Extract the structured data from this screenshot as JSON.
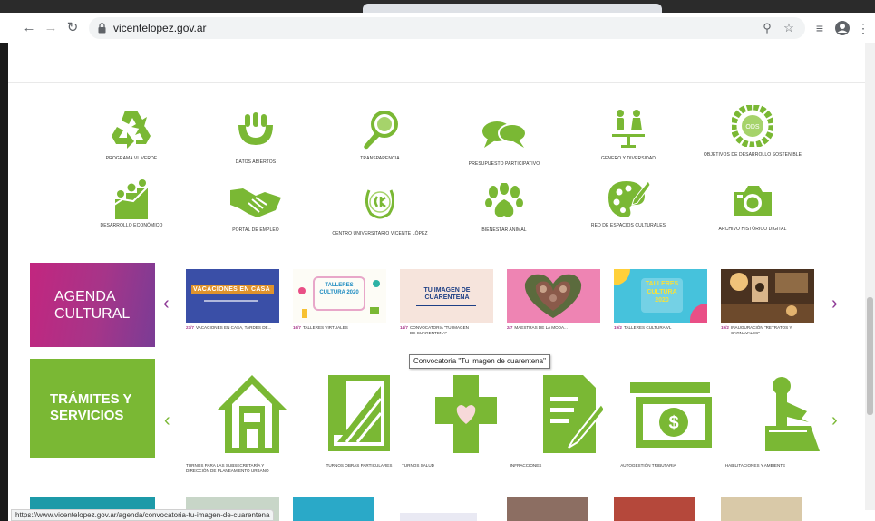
{
  "browser": {
    "url": "vicentelopez.gov.ar",
    "status_url": "https://www.vicentelopez.gov.ar/agenda/convocatoria-tu-imagen-de-cuarentena",
    "icons": [
      "back-arrow-icon",
      "forward-arrow-icon",
      "reload-icon",
      "lock-icon",
      "zoom-icon",
      "star-icon",
      "reading-list-icon",
      "profile-icon",
      "more-icon"
    ]
  },
  "grid": {
    "row1": [
      {
        "label": "PROGRAMA VL VERDE",
        "icon": "recycle-icon"
      },
      {
        "label": "DATOS ABIERTOS",
        "icon": "open-data-icon"
      },
      {
        "label": "TRANSPARENCIA",
        "icon": "magnifier-icon"
      },
      {
        "label": "PRESUPUESTO PARTICIPATIVO",
        "icon": "speech-bubbles-icon"
      },
      {
        "label": "GENERO Y DIVERSIDAD",
        "icon": "people-balance-icon"
      },
      {
        "label": "OBJETIVOS DE DESARROLLO SOSTENIBLE",
        "icon": "ods-wheel-icon"
      }
    ],
    "row2": [
      {
        "label": "DESARROLLO ECONÓMICO",
        "icon": "growth-people-icon"
      },
      {
        "label": "PORTAL DE EMPLEO",
        "icon": "handshake-icon"
      },
      {
        "label": "CENTRO UNIVERSITARIO VICENTE LÓPEZ",
        "icon": "laurel-emblem-icon"
      },
      {
        "label": "BIENESTAR ANIMAL",
        "icon": "paw-icon"
      },
      {
        "label": "RED DE ESPACIOS CULTURALES",
        "icon": "palette-icon"
      },
      {
        "label": "ARCHIVO HISTÓRICO DIGITAL",
        "icon": "camera-icon"
      }
    ],
    "ods_text": "ODS"
  },
  "agenda": {
    "title": "AGENDA CULTURAL",
    "items": [
      {
        "date": "23/7",
        "caption": "VACACIONES EN CASA, TARDES DE...",
        "image_text": "VACACIONES EN CASA"
      },
      {
        "date": "16/7",
        "caption": "TALLERES VIRTUALES",
        "image_text": "TALLERES CULTURA 2020"
      },
      {
        "date": "14/7",
        "caption": "CONVOCATORIA \"TU IMAGEN DE CUARENTENA\"",
        "image_text": "TU IMAGEN DE CUARENTENA"
      },
      {
        "date": "2/7",
        "caption": "MAESTRAS DE LA MODA...",
        "image_text": ""
      },
      {
        "date": "19/2",
        "caption": "TALLERES CULTURA VL",
        "image_text": "TALLERES CULTURA 2020"
      },
      {
        "date": "19/2",
        "caption": "INAUGURACIÓN \"RETRATOS Y CARNAVALES\"",
        "image_text": ""
      }
    ]
  },
  "tooltip": "Convocatoria \"Tu imagen de cuarentena\"",
  "tramites": {
    "title": "TRÁMITES Y SERVICIOS",
    "items": [
      {
        "label": "TURNOS PARA LAS SUBSECRETARÍA Y DIRECCIÓN DE PLANEAMIENTO URBANO",
        "icon": "house-icon"
      },
      {
        "label": "TURNOS OBRAS PARTICULARES",
        "icon": "blueprint-icon"
      },
      {
        "label": "TURNOS SALUD",
        "icon": "health-cross-icon"
      },
      {
        "label": "INFRACCIONES",
        "icon": "document-edit-icon"
      },
      {
        "label": "AUTOGESTIÓN TRIBUTARIA",
        "icon": "money-bill-icon"
      },
      {
        "label": "HABILITACIONES Y AMBIENTE",
        "icon": "stamp-icon"
      }
    ]
  },
  "colors": {
    "green": "#7ab834",
    "purple": "#a63589",
    "magenta": "#c2267f"
  }
}
